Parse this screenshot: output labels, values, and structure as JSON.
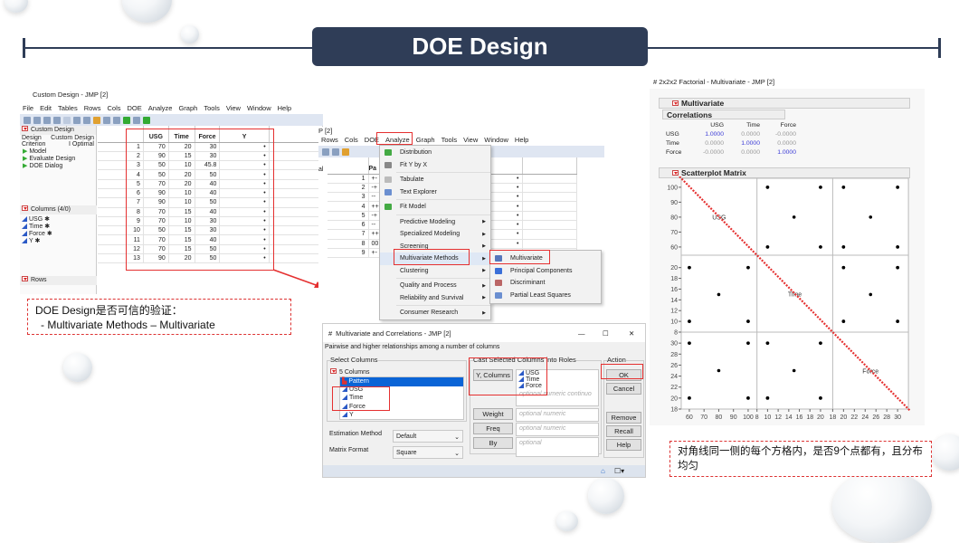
{
  "slide": {
    "title": "DOE Design"
  },
  "colors": {
    "navy": "#2f3d57",
    "highlight_red": "#e53030",
    "jmp_blue": "#2a59c6",
    "corr_blue": "#3b3bd6"
  },
  "left_window": {
    "title": "Custom Design - JMP [2]",
    "menu": [
      "File",
      "Edit",
      "Tables",
      "Rows",
      "Cols",
      "DOE",
      "Analyze",
      "Graph",
      "Tools",
      "View",
      "Window",
      "Help"
    ],
    "panel": {
      "header": "Custom Design",
      "design_label": "Design",
      "design_value": "Custom Design",
      "criterion_label": "Criterion",
      "criterion_value": "I Optimal",
      "items": [
        "Model",
        "Evaluate Design",
        "DOE Dialog"
      ]
    },
    "columns_header": "Columns (4/0)",
    "columns": [
      "USG",
      "Time",
      "Force",
      "Y"
    ],
    "rows_header": "Rows",
    "table": {
      "headers": [
        "USG",
        "Time",
        "Force",
        "Y"
      ],
      "rows": [
        [
          1,
          70,
          20,
          30,
          "•"
        ],
        [
          2,
          90,
          15,
          30,
          "•"
        ],
        [
          3,
          50,
          10,
          45.8,
          "•"
        ],
        [
          4,
          50,
          20,
          50,
          "•"
        ],
        [
          5,
          70,
          20,
          40,
          "•"
        ],
        [
          6,
          90,
          10,
          40,
          "•"
        ],
        [
          7,
          90,
          10,
          50,
          "•"
        ],
        [
          8,
          70,
          15,
          40,
          "•"
        ],
        [
          9,
          70,
          10,
          30,
          "•"
        ],
        [
          10,
          50,
          15,
          30,
          "•"
        ],
        [
          11,
          70,
          15,
          40,
          "•"
        ],
        [
          12,
          70,
          15,
          50,
          "•"
        ],
        [
          13,
          90,
          20,
          50,
          "•"
        ]
      ]
    }
  },
  "callout_left": {
    "line1": "DOE Design是否可信的验证：",
    "line2": "- Multivariate Methods – Multivariate"
  },
  "middle_window": {
    "title_fragment": "P [2]",
    "menu": [
      "Rows",
      "Cols",
      "DOE",
      "Analyze",
      "Graph",
      "Tools",
      "View",
      "Window",
      "Help"
    ],
    "side_fragment": "al",
    "headers": [
      "Pa",
      "Y"
    ],
    "rows": [
      [
        1,
        "+-",
        "•"
      ],
      [
        2,
        "-+",
        "•"
      ],
      [
        3,
        "--",
        "•"
      ],
      [
        4,
        "++",
        "•"
      ],
      [
        5,
        "-+",
        "•"
      ],
      [
        6,
        "--",
        "•"
      ],
      [
        7,
        "++",
        "•"
      ],
      [
        8,
        "00",
        "•"
      ],
      [
        9,
        "+-",
        ""
      ]
    ],
    "analyze_menu": [
      {
        "label": "Distribution",
        "icon": "distribution-icon"
      },
      {
        "label": "Fit Y by X",
        "icon": "fit-y-by-x-icon"
      },
      {
        "sep": true
      },
      {
        "label": "Tabulate",
        "icon": "tabulate-icon"
      },
      {
        "label": "Text Explorer",
        "icon": "text-explorer-icon"
      },
      {
        "sep": true
      },
      {
        "label": "Fit Model",
        "icon": "fit-model-icon"
      },
      {
        "sep": true
      },
      {
        "label": "Predictive Modeling",
        "sub": true
      },
      {
        "label": "Specialized Modeling",
        "sub": true
      },
      {
        "label": "Screening",
        "sub": true
      },
      {
        "label": "Multivariate Methods",
        "sub": true,
        "active": true
      },
      {
        "label": "Clustering",
        "sub": true
      },
      {
        "sep": true
      },
      {
        "label": "Quality and Process",
        "sub": true
      },
      {
        "label": "Reliability and Survival",
        "sub": true
      },
      {
        "sep": true
      },
      {
        "label": "Consumer Research",
        "sub": true
      }
    ],
    "submenu": [
      {
        "label": "Multivariate",
        "icon": "multivariate-icon"
      },
      {
        "label": "Principal Components",
        "icon": "principal-components-icon"
      },
      {
        "label": "Discriminant",
        "icon": "discriminant-icon"
      },
      {
        "label": "Partial Least Squares",
        "icon": "pls-icon"
      }
    ]
  },
  "dialog": {
    "title": "Multivariate and Correlations - JMP [2]",
    "description": "Pairwise and higher relationships among a number of columns",
    "select_columns_label": "Select Columns",
    "columns_count": "5 Columns",
    "columns": [
      "Pattern",
      "USG",
      "Time",
      "Force",
      "Y"
    ],
    "cast_label": "Cast Selected Columns into Roles",
    "roles": [
      {
        "button": "Y, Columns",
        "values": [
          "USG",
          "Time",
          "Force"
        ],
        "placeholder": "optional numeric continuo"
      },
      {
        "button": "Weight",
        "placeholder": "optional numeric"
      },
      {
        "button": "Freq",
        "placeholder": "optional numeric"
      },
      {
        "button": "By",
        "placeholder": "optional"
      }
    ],
    "action_label": "Action",
    "actions": [
      "OK",
      "Cancel",
      "Remove",
      "Recall",
      "Help"
    ],
    "estimation_label": "Estimation Method",
    "estimation_value": "Default",
    "matrix_label": "Matrix Format",
    "matrix_value": "Square"
  },
  "right_window": {
    "title": "2x2x2 Factorial - Multivariate - JMP [2]",
    "multivariate_header": "Multivariate",
    "correlations_header": "Correlations",
    "corr_columns": [
      "USG",
      "Time",
      "Force"
    ],
    "corr_rows": [
      {
        "name": "USG",
        "values": [
          "1.0000",
          "0.0000",
          "-0.0000"
        ]
      },
      {
        "name": "Time",
        "values": [
          "0.0000",
          "1.0000",
          "0.0000"
        ]
      },
      {
        "name": "Force",
        "values": [
          "-0.0000",
          "0.0000",
          "1.0000"
        ]
      }
    ],
    "scatter_header": "Scatterplot Matrix"
  },
  "chart_data": {
    "type": "scatter",
    "variables": [
      "USG",
      "Time",
      "Force"
    ],
    "ranges": {
      "USG": [
        54.5,
        106
      ],
      "Time": [
        8,
        22.3
      ],
      "Force": [
        18,
        32
      ]
    },
    "ticks": {
      "USG": [
        60,
        70,
        80,
        90,
        100
      ],
      "Time": [
        8,
        10,
        12,
        14,
        16,
        18,
        20
      ],
      "Force": [
        18,
        20,
        22,
        24,
        26,
        28,
        30
      ]
    },
    "points": [
      {
        "USG": 60,
        "Time": 10,
        "Force": 20
      },
      {
        "USG": 60,
        "Time": 10,
        "Force": 30
      },
      {
        "USG": 60,
        "Time": 20,
        "Force": 20
      },
      {
        "USG": 60,
        "Time": 20,
        "Force": 30
      },
      {
        "USG": 100,
        "Time": 10,
        "Force": 20
      },
      {
        "USG": 100,
        "Time": 10,
        "Force": 30
      },
      {
        "USG": 100,
        "Time": 20,
        "Force": 20
      },
      {
        "USG": 100,
        "Time": 20,
        "Force": 30
      },
      {
        "USG": 80,
        "Time": 15,
        "Force": 25
      }
    ],
    "annotation": "red dotted diagonal line"
  },
  "callout_right": {
    "text": "对角线同一侧的每个方格内，是否9个点都有，且分布均匀"
  }
}
